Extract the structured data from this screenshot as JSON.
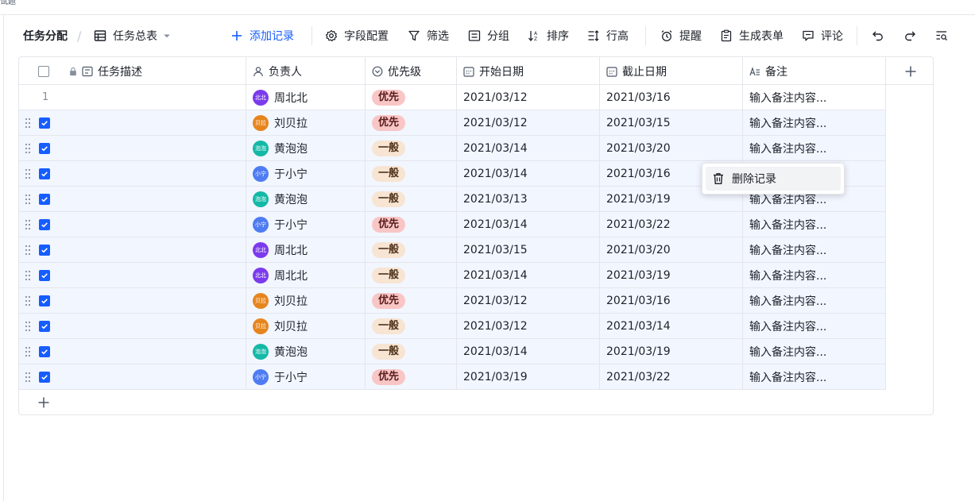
{
  "corner_text": "试题",
  "breadcrumb": {
    "title": "任务分配",
    "sheet": "任务总表"
  },
  "toolbar": {
    "add_record": "添加记录",
    "field_config": "字段配置",
    "filter": "筛选",
    "group": "分组",
    "sort": "排序",
    "row_height": "行高",
    "remind": "提醒",
    "generate_form": "生成表单",
    "comment": "评论"
  },
  "columns": {
    "desc": "任务描述",
    "owner": "负责人",
    "priority": "优先级",
    "start": "开始日期",
    "due": "截止日期",
    "note": "备注"
  },
  "colors": {
    "accent": "#165dff",
    "avatar_zhou": "#7c3aed",
    "avatar_liu": "#e6851e",
    "avatar_huang": "#14b8a6",
    "avatar_yu": "#4f7cf2",
    "tag_high": "#f9c6c6",
    "tag_normal": "#f7e4d2"
  },
  "rows": [
    {
      "num": "1",
      "checked": false,
      "avatar": "北北",
      "owner": "周北北",
      "priority": "优先",
      "start": "2021/03/12",
      "due": "2021/03/16",
      "note": "输入备注内容..."
    },
    {
      "num": "",
      "checked": true,
      "avatar": "贝拉",
      "owner": "刘贝拉",
      "priority": "优先",
      "start": "2021/03/12",
      "due": "2021/03/15",
      "note": "输入备注内容..."
    },
    {
      "num": "",
      "checked": true,
      "avatar": "泡泡",
      "owner": "黄泡泡",
      "priority": "一般",
      "start": "2021/03/14",
      "due": "2021/03/20",
      "note": "输入备注内容..."
    },
    {
      "num": "",
      "checked": true,
      "avatar": "小宁",
      "owner": "于小宁",
      "priority": "一般",
      "start": "2021/03/14",
      "due": "2021/03/16",
      "note": ""
    },
    {
      "num": "",
      "checked": true,
      "avatar": "泡泡",
      "owner": "黄泡泡",
      "priority": "一般",
      "start": "2021/03/13",
      "due": "2021/03/19",
      "note": "输入备注内容..."
    },
    {
      "num": "",
      "checked": true,
      "avatar": "小宁",
      "owner": "于小宁",
      "priority": "优先",
      "start": "2021/03/14",
      "due": "2021/03/22",
      "note": "输入备注内容..."
    },
    {
      "num": "",
      "checked": true,
      "avatar": "北北",
      "owner": "周北北",
      "priority": "一般",
      "start": "2021/03/15",
      "due": "2021/03/20",
      "note": "输入备注内容..."
    },
    {
      "num": "",
      "checked": true,
      "avatar": "北北",
      "owner": "周北北",
      "priority": "一般",
      "start": "2021/03/14",
      "due": "2021/03/19",
      "note": "输入备注内容..."
    },
    {
      "num": "",
      "checked": true,
      "avatar": "贝拉",
      "owner": "刘贝拉",
      "priority": "优先",
      "start": "2021/03/12",
      "due": "2021/03/16",
      "note": "输入备注内容..."
    },
    {
      "num": "",
      "checked": true,
      "avatar": "贝拉",
      "owner": "刘贝拉",
      "priority": "一般",
      "start": "2021/03/12",
      "due": "2021/03/14",
      "note": "输入备注内容..."
    },
    {
      "num": "",
      "checked": true,
      "avatar": "泡泡",
      "owner": "黄泡泡",
      "priority": "一般",
      "start": "2021/03/14",
      "due": "2021/03/19",
      "note": "输入备注内容..."
    },
    {
      "num": "",
      "checked": true,
      "avatar": "小宁",
      "owner": "于小宁",
      "priority": "优先",
      "start": "2021/03/19",
      "due": "2021/03/22",
      "note": "输入备注内容..."
    }
  ],
  "context_menu": {
    "delete": "删除记录"
  }
}
